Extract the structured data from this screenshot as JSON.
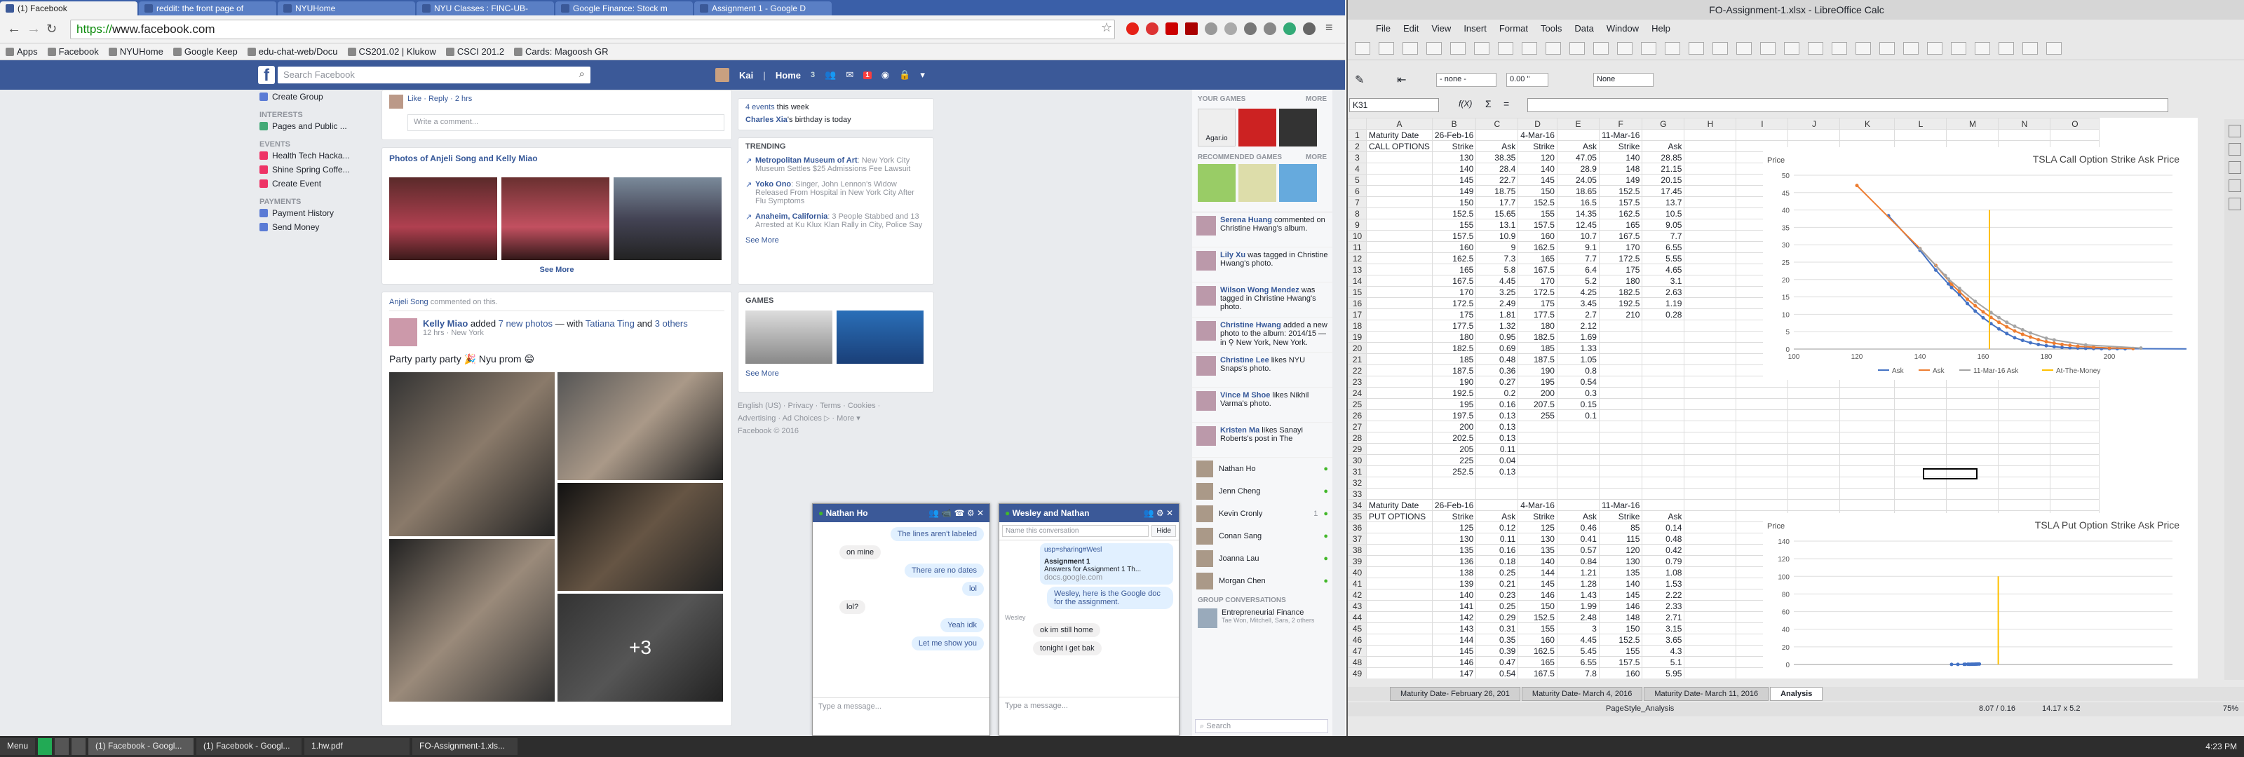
{
  "browser": {
    "tabs": [
      {
        "title": "(1) Facebook"
      },
      {
        "title": "reddit: the front page of"
      },
      {
        "title": "NYUHome"
      },
      {
        "title": "NYU Classes : FINC-UB-"
      },
      {
        "title": "Google Finance: Stock m"
      },
      {
        "title": "Assignment 1 - Google D"
      }
    ],
    "url_scheme": "https://",
    "url_rest": "www.facebook.com",
    "bookmarks": [
      "Apps",
      "Facebook",
      "NYUHome",
      "Google Keep",
      "edu-chat-web/Docu",
      "CS201.02 | Klukow",
      "CSCI 201.2",
      "Cards: Magoosh GR"
    ]
  },
  "facebook": {
    "search_placeholder": "Search Facebook",
    "user": "Kai",
    "home": "Home",
    "home_count": "3",
    "notif_count": "1",
    "left_nav": {
      "create_group": "Create Group",
      "interests_hdr": "INTERESTS",
      "pages_public": "Pages and Public ...",
      "events_hdr": "EVENTS",
      "events": [
        "Health Tech Hacka...",
        "Shine Spring Coffe...",
        "Create Event"
      ],
      "payments_hdr": "PAYMENTS",
      "payments": [
        "Payment History",
        "Send Money"
      ]
    },
    "top_post": {
      "actions": "Like · Reply · 2 hrs",
      "comment_placeholder": "Write a comment..."
    },
    "photos_card": {
      "title": "Photos of Anjeli Song and Kelly Miao",
      "see_more": "See More"
    },
    "post": {
      "header_author": "Anjeli Song",
      "header_rest": " commented on this.",
      "author": "Kelly Miao",
      "added": " added ",
      "new_photos": "7 new photos",
      "with": " — with ",
      "tagged1": "Tatiana Ting",
      "and": " and ",
      "tagged2": "3 others",
      "meta": "12 hrs · New York",
      "text": "Party party party 🎉 Nyu prom 😄",
      "more": "+3"
    },
    "events_box": {
      "events_link": "4 events",
      "events_rest": " this week",
      "bday_name": "Charles Xia",
      "bday_rest": "'s birthday is today"
    },
    "trending": {
      "title": "TRENDING",
      "items": [
        {
          "name": "Metropolitan Museum of Art",
          "desc": ": New York City Museum Settles $25 Admissions Fee Lawsuit"
        },
        {
          "name": "Yoko Ono",
          "desc": ": Singer, John Lennon's Widow Released From Hospital in New York City After Flu Symptoms"
        },
        {
          "name": "Anaheim, California",
          "desc": ": 3 People Stabbed and 13 Arrested at Ku Klux Klan Rally in City, Police Say"
        }
      ],
      "see_more": "See More"
    },
    "games": {
      "title": "GAMES",
      "see_more": "See More"
    },
    "footer": {
      "line1": "English (US) · Privacy · Terms · Cookies ·",
      "line2": "Advertising · Ad Choices ▷ · More ▾",
      "line3": "Facebook © 2016"
    },
    "right_col": {
      "your_games": "YOUR GAMES",
      "more": "MORE",
      "agario": "Agar.io",
      "recommended": "RECOMMENDED GAMES",
      "ticker": [
        {
          "name": "Serena Huang",
          "text": " commented on Christine Hwang's album."
        },
        {
          "name": "Lily Xu",
          "text": " was tagged in Christine Hwang's photo."
        },
        {
          "name": "Wilson Wong Mendez",
          "text": " was tagged in Christine Hwang's photo."
        },
        {
          "name": "Christine Hwang",
          "text": " added a new photo to the album: 2014/15 — in ⚲ New York, New York."
        },
        {
          "name": "Christine Lee",
          "text": " likes NYU Snaps's photo."
        },
        {
          "name": "Vince M Shoe",
          "text": " likes Nikhil Varma's photo."
        },
        {
          "name": "Kristen Ma",
          "text": " likes Sanayi Roberts's post in The"
        }
      ],
      "contacts": [
        {
          "name": "Nathan Ho",
          "extra": ""
        },
        {
          "name": "Jenn Cheng",
          "extra": ""
        },
        {
          "name": "Kevin Cronly",
          "extra": "1"
        },
        {
          "name": "Conan Sang",
          "extra": ""
        },
        {
          "name": "Joanna Lau",
          "extra": ""
        },
        {
          "name": "Morgan Chen",
          "extra": ""
        }
      ],
      "group_conv": "GROUP CONVERSATIONS",
      "group_name": "Entrepreneurial Finance",
      "group_members": "Tae Won, Mitchell, Sara, 2 others",
      "search": "Search"
    },
    "chat1": {
      "name": "Nathan Ho",
      "messages": [
        {
          "from": "me",
          "text": "The lines aren't labeled"
        },
        {
          "from": "them",
          "text": "on mine"
        },
        {
          "from": "me",
          "text": "There are no dates"
        },
        {
          "from": "me",
          "text": "lol"
        },
        {
          "from": "them",
          "text": "lol?"
        },
        {
          "from": "me",
          "text": "Yeah idk"
        },
        {
          "from": "me",
          "text": "Let me show you"
        }
      ],
      "placeholder": "Type a message..."
    },
    "chat2": {
      "name": "Wesley and Nathan",
      "conv_placeholder": "Name this conversation",
      "hide": "Hide",
      "link_url": "usp=sharing#Wesl",
      "link_title": "Assignment 1",
      "link_desc": "Answers for Assignment 1 Th...",
      "link_domain": "docs.google.com",
      "msg_me": "Wesley, here is the Google doc for the assignment.",
      "sender": "Wesley",
      "msgs_them": [
        "ok im still home",
        "tonight i get bak"
      ],
      "placeholder": "Type a message..."
    }
  },
  "calc": {
    "title": "FO-Assignment-1.xlsx - LibreOffice Calc",
    "menu": [
      "File",
      "Edit",
      "View",
      "Insert",
      "Format",
      "Tools",
      "Data",
      "Window",
      "Help"
    ],
    "line_style": "- none -",
    "line_width": "0.00 \"",
    "area": "None",
    "namebox": "K31",
    "fx": "f(X)",
    "sigma": "Σ",
    "eq": "=",
    "col_headers": [
      "A",
      "B",
      "C",
      "D",
      "E",
      "F",
      "G",
      "H",
      "I",
      "J",
      "K",
      "L",
      "M",
      "N",
      "O"
    ],
    "rows_top": [
      [
        "Maturity Date",
        "26-Feb-16",
        "",
        "4-Mar-16",
        "",
        "11-Mar-16",
        ""
      ],
      [
        "CALL OPTIONS",
        "Strike",
        "Ask",
        "Strike",
        "Ask",
        "Strike",
        "Ask"
      ],
      [
        "",
        "130",
        "38.35",
        "120",
        "47.05",
        "140",
        "28.85"
      ],
      [
        "",
        "140",
        "28.4",
        "140",
        "28.9",
        "148",
        "21.15"
      ],
      [
        "",
        "145",
        "22.7",
        "145",
        "24.05",
        "149",
        "20.15"
      ],
      [
        "",
        "149",
        "18.75",
        "150",
        "18.65",
        "152.5",
        "17.45"
      ],
      [
        "",
        "150",
        "17.7",
        "152.5",
        "16.5",
        "157.5",
        "13.7"
      ],
      [
        "",
        "152.5",
        "15.65",
        "155",
        "14.35",
        "162.5",
        "10.5"
      ],
      [
        "",
        "155",
        "13.1",
        "157.5",
        "12.45",
        "165",
        "9.05"
      ],
      [
        "",
        "157.5",
        "10.9",
        "160",
        "10.7",
        "167.5",
        "7.7"
      ],
      [
        "",
        "160",
        "9",
        "162.5",
        "9.1",
        "170",
        "6.55"
      ],
      [
        "",
        "162.5",
        "7.3",
        "165",
        "7.7",
        "172.5",
        "5.55"
      ],
      [
        "",
        "165",
        "5.8",
        "167.5",
        "6.4",
        "175",
        "4.65"
      ],
      [
        "",
        "167.5",
        "4.45",
        "170",
        "5.2",
        "180",
        "3.1"
      ],
      [
        "",
        "170",
        "3.25",
        "172.5",
        "4.25",
        "182.5",
        "2.63"
      ],
      [
        "",
        "172.5",
        "2.49",
        "175",
        "3.45",
        "192.5",
        "1.19"
      ],
      [
        "",
        "175",
        "1.81",
        "177.5",
        "2.7",
        "210",
        "0.28"
      ],
      [
        "",
        "177.5",
        "1.32",
        "180",
        "2.12",
        "",
        ""
      ],
      [
        "",
        "180",
        "0.95",
        "182.5",
        "1.69",
        "",
        ""
      ],
      [
        "",
        "182.5",
        "0.69",
        "185",
        "1.33",
        "",
        ""
      ],
      [
        "",
        "185",
        "0.48",
        "187.5",
        "1.05",
        "",
        ""
      ],
      [
        "",
        "187.5",
        "0.36",
        "190",
        "0.8",
        "",
        ""
      ],
      [
        "",
        "190",
        "0.27",
        "195",
        "0.54",
        "",
        ""
      ],
      [
        "",
        "192.5",
        "0.2",
        "200",
        "0.3",
        "",
        ""
      ],
      [
        "",
        "195",
        "0.16",
        "207.5",
        "0.15",
        "",
        ""
      ],
      [
        "",
        "197.5",
        "0.13",
        "255",
        "0.1",
        "",
        ""
      ],
      [
        "",
        "200",
        "0.13",
        "",
        "",
        "",
        ""
      ],
      [
        "",
        "202.5",
        "0.13",
        "",
        "",
        "",
        ""
      ],
      [
        "",
        "205",
        "0.11",
        "",
        "",
        "",
        ""
      ],
      [
        "",
        "225",
        "0.04",
        "",
        "",
        "",
        ""
      ],
      [
        "",
        "252.5",
        "0.13",
        "",
        "",
        "",
        ""
      ],
      [
        "",
        "",
        "",
        "",
        "",
        "",
        ""
      ],
      [
        "",
        "",
        "",
        "",
        "",
        "",
        ""
      ]
    ],
    "rows_bottom": [
      [
        "Maturity Date",
        "26-Feb-16",
        "",
        "4-Mar-16",
        "",
        "11-Mar-16",
        ""
      ],
      [
        "PUT OPTIONS",
        "Strike",
        "Ask",
        "Strike",
        "Ask",
        "Strike",
        "Ask"
      ],
      [
        "",
        "125",
        "0.12",
        "125",
        "0.46",
        "85",
        "0.14"
      ],
      [
        "",
        "130",
        "0.11",
        "130",
        "0.41",
        "115",
        "0.48"
      ],
      [
        "",
        "135",
        "0.16",
        "135",
        "0.57",
        "120",
        "0.42"
      ],
      [
        "",
        "136",
        "0.18",
        "140",
        "0.84",
        "130",
        "0.79"
      ],
      [
        "",
        "138",
        "0.25",
        "144",
        "1.21",
        "135",
        "1.08"
      ],
      [
        "",
        "139",
        "0.21",
        "145",
        "1.28",
        "140",
        "1.53"
      ],
      [
        "",
        "140",
        "0.23",
        "146",
        "1.43",
        "145",
        "2.22"
      ],
      [
        "",
        "141",
        "0.25",
        "150",
        "1.99",
        "146",
        "2.33"
      ],
      [
        "",
        "142",
        "0.29",
        "152.5",
        "2.48",
        "148",
        "2.71"
      ],
      [
        "",
        "143",
        "0.31",
        "155",
        "3",
        "150",
        "3.15"
      ],
      [
        "",
        "144",
        "0.35",
        "160",
        "4.45",
        "152.5",
        "3.65"
      ],
      [
        "",
        "145",
        "0.39",
        "162.5",
        "5.45",
        "155",
        "4.3"
      ],
      [
        "",
        "146",
        "0.47",
        "165",
        "6.55",
        "157.5",
        "5.1"
      ],
      [
        "",
        "147",
        "0.54",
        "167.5",
        "7.8",
        "160",
        "5.95"
      ]
    ],
    "sheet_tabs": [
      "Maturity Date- February 26, 201",
      "Maturity Date- March 4, 2016",
      "Maturity Date- March 11, 2016",
      "Analysis"
    ],
    "status_left": "PageStyle_Analysis",
    "status_right": "8.07 / 0.16",
    "status_size": "14.17 x 5.2",
    "zoom": "75%"
  },
  "chart_data": [
    {
      "type": "line",
      "title": "TSLA Call Option Strike Ask Price",
      "ylabel": "Price",
      "xlabel": "",
      "xlim": [
        100,
        220
      ],
      "ylim": [
        0,
        50
      ],
      "xticks": [
        100,
        120,
        140,
        160,
        180,
        200
      ],
      "yticks": [
        0,
        5,
        10,
        15,
        20,
        25,
        30,
        35,
        40,
        45,
        50
      ],
      "legend_position": "bottom",
      "series": [
        {
          "name": "Ask",
          "color": "#4472c4",
          "x": [
            130,
            140,
            145,
            149,
            150,
            152.5,
            155,
            157.5,
            160,
            162.5,
            165,
            167.5,
            170,
            172.5,
            175,
            177.5,
            180,
            182.5,
            185,
            187.5,
            190,
            192.5,
            195,
            197.5,
            200,
            202.5,
            205,
            225
          ],
          "y": [
            38.35,
            28.4,
            22.7,
            18.75,
            17.7,
            15.65,
            13.1,
            10.9,
            9,
            7.3,
            5.8,
            4.45,
            3.25,
            2.49,
            1.81,
            1.32,
            0.95,
            0.69,
            0.48,
            0.36,
            0.27,
            0.2,
            0.16,
            0.13,
            0.13,
            0.13,
            0.11,
            0.04
          ]
        },
        {
          "name": "Ask",
          "color": "#ed7d31",
          "x": [
            120,
            140,
            145,
            150,
            152.5,
            155,
            157.5,
            160,
            162.5,
            165,
            167.5,
            170,
            172.5,
            175,
            177.5,
            180,
            182.5,
            185,
            187.5,
            190,
            195,
            200,
            207.5
          ],
          "y": [
            47.05,
            28.9,
            24.05,
            18.65,
            16.5,
            14.35,
            12.45,
            10.7,
            9.1,
            7.7,
            6.4,
            5.2,
            4.25,
            3.45,
            2.7,
            2.12,
            1.69,
            1.33,
            1.05,
            0.8,
            0.54,
            0.3,
            0.15
          ]
        },
        {
          "name": "11-Mar-16 Ask",
          "color": "#a5a5a5",
          "x": [
            140,
            148,
            149,
            152.5,
            157.5,
            162.5,
            165,
            167.5,
            170,
            172.5,
            175,
            180,
            182.5,
            192.5,
            210
          ],
          "y": [
            28.85,
            21.15,
            20.15,
            17.45,
            13.7,
            10.5,
            9.05,
            7.7,
            6.55,
            5.55,
            4.65,
            3.1,
            2.63,
            1.19,
            0.28
          ]
        },
        {
          "name": "At-The-Money",
          "color": "#ffc000",
          "x": [
            162,
            162
          ],
          "y": [
            0,
            40
          ]
        }
      ]
    },
    {
      "type": "line",
      "title": "TSLA Put Option Strike Ask Price",
      "ylabel": "Price",
      "xlabel": "",
      "xlim": [
        0,
        300
      ],
      "ylim": [
        0,
        140
      ],
      "yticks": [
        0,
        20,
        40,
        60,
        80,
        100,
        120,
        140
      ],
      "series": [
        {
          "name": "Ask",
          "color": "#4472c4",
          "x": [
            125,
            130,
            135,
            136,
            138,
            139,
            140,
            141,
            142,
            143,
            144,
            145,
            146,
            147
          ],
          "y": [
            0.12,
            0.11,
            0.16,
            0.18,
            0.25,
            0.21,
            0.23,
            0.25,
            0.29,
            0.31,
            0.35,
            0.39,
            0.47,
            0.54
          ]
        },
        {
          "name": "At-The-Money",
          "color": "#ffc000",
          "x": [
            162,
            162
          ],
          "y": [
            0,
            100
          ]
        }
      ]
    }
  ],
  "taskbar": {
    "menu": "Menu",
    "items": [
      "(1) Facebook - Googl...",
      "(1) Facebook - Googl...",
      "1.hw.pdf",
      "FO-Assignment-1.xls..."
    ],
    "clock": "4:23 PM"
  }
}
